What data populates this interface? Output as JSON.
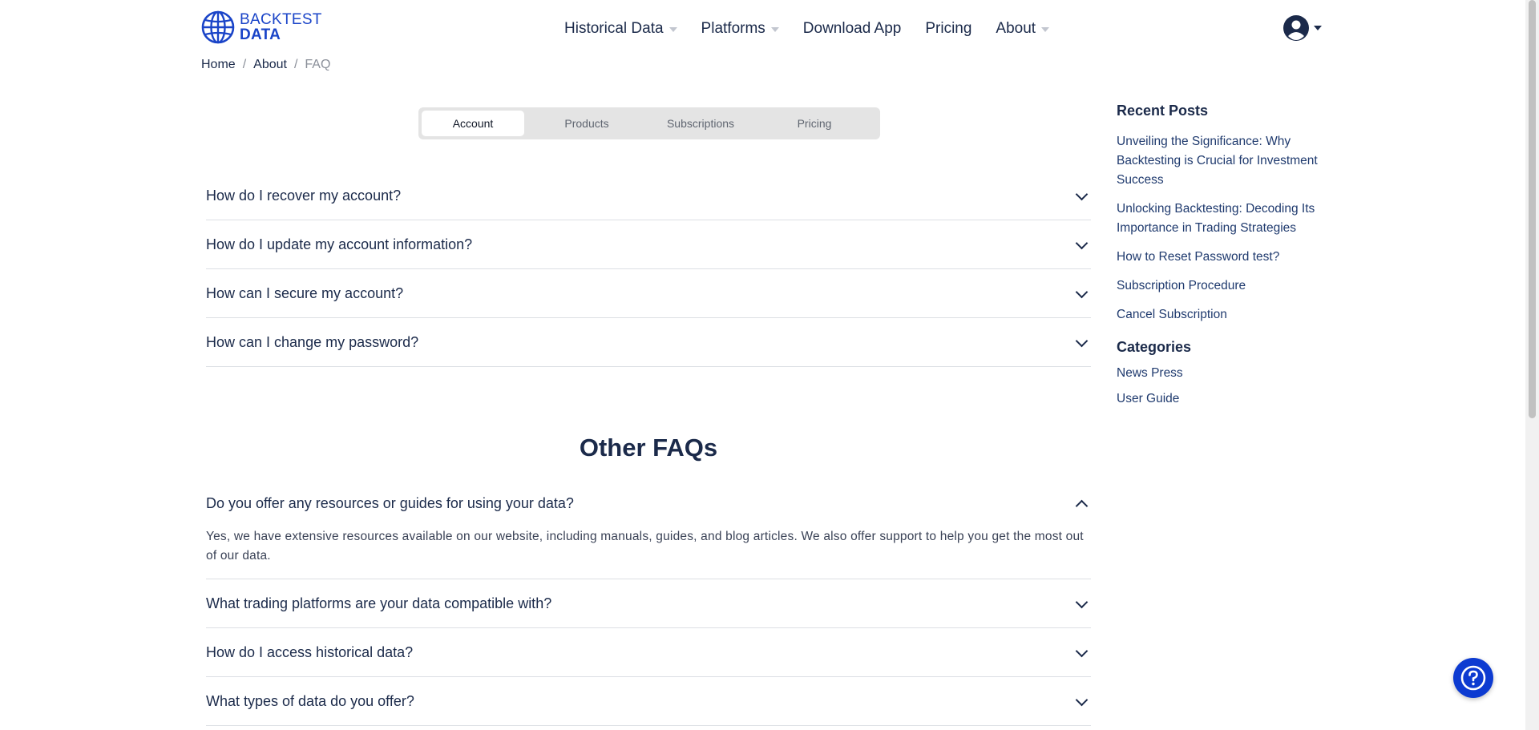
{
  "brand": {
    "line1": "BACKTEST",
    "line2": "DATA",
    "color": "#1a44c8"
  },
  "nav": {
    "items": [
      {
        "label": "Historical Data",
        "dropdown": true
      },
      {
        "label": "Platforms",
        "dropdown": true
      },
      {
        "label": "Download App",
        "dropdown": false
      },
      {
        "label": "Pricing",
        "dropdown": false
      },
      {
        "label": "About",
        "dropdown": true
      }
    ]
  },
  "account": {
    "icon": "user-circle-icon"
  },
  "breadcrumb": {
    "home": "Home",
    "about": "About",
    "current": "FAQ",
    "separator": "/"
  },
  "tabs": [
    {
      "label": "Account",
      "active": true
    },
    {
      "label": "Products",
      "active": false
    },
    {
      "label": "Subscriptions",
      "active": false
    },
    {
      "label": "Pricing",
      "active": false
    }
  ],
  "account_faqs": [
    {
      "question": "How do I recover my account?"
    },
    {
      "question": "How do I update my account information?"
    },
    {
      "question": "How can I secure my account?"
    },
    {
      "question": "How can I change my password?"
    }
  ],
  "other_faqs": {
    "title": "Other FAQs",
    "items": [
      {
        "question": "Do you offer any resources or guides for using your data?",
        "expanded": true,
        "answer": "Yes, we have extensive resources available on our website, including manuals, guides, and blog articles. We also offer support to help you get the most out of our data."
      },
      {
        "question": "What trading platforms are your data compatible with?",
        "expanded": false
      },
      {
        "question": "How do I access historical data?",
        "expanded": false
      },
      {
        "question": "What types of data do you offer?",
        "expanded": false
      }
    ]
  },
  "sidebar": {
    "recent_title": "Recent Posts",
    "recent_posts": [
      "Unveiling the Significance: Why Backtesting is Crucial for Investment Success",
      "Unlocking Backtesting: Decoding Its Importance in Trading Strategies",
      "How to Reset Password test?",
      "Subscription Procedure",
      "Cancel Subscription"
    ],
    "categories_title": "Categories",
    "categories": [
      "News Press",
      "User Guide"
    ]
  },
  "help": {
    "icon": "question-mark-icon",
    "color": "#0d3bd1"
  }
}
